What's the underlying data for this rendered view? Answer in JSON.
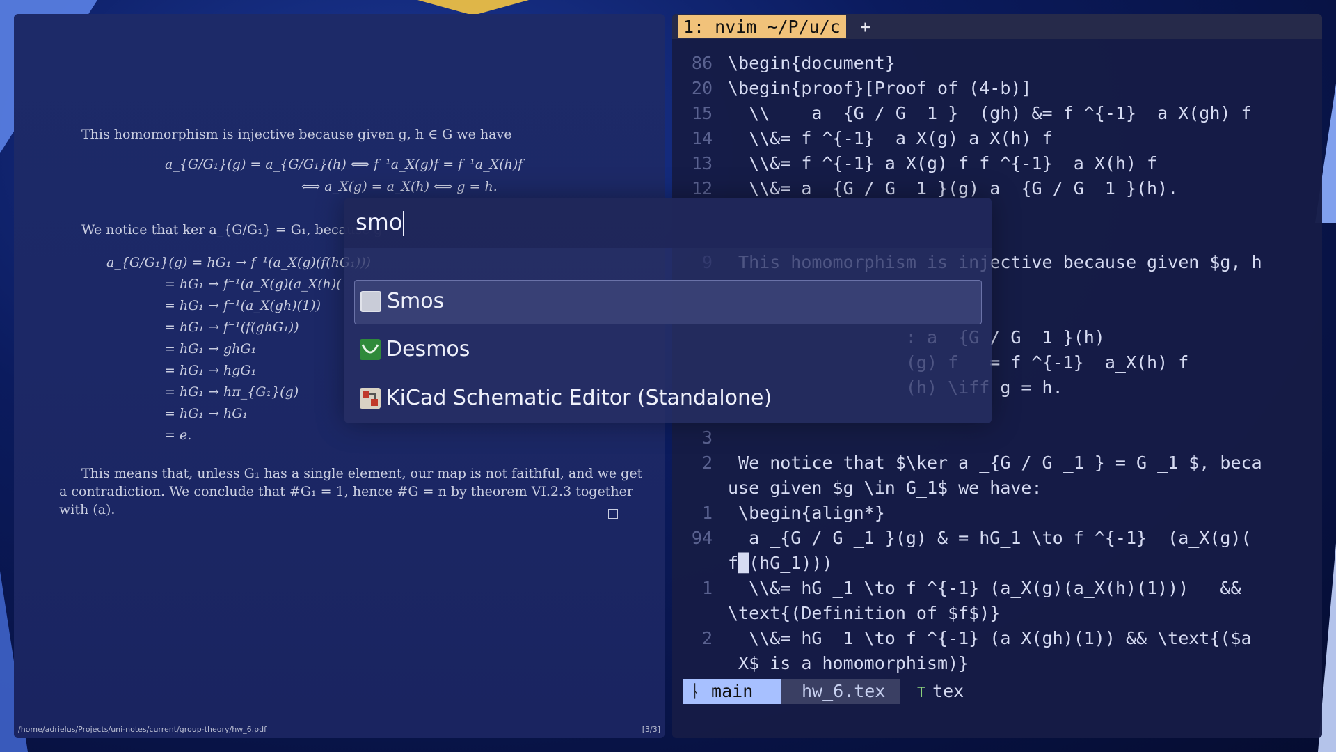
{
  "pdf": {
    "para1": "This homomorphism is injective because given g, h ∈ G we have",
    "eq1_l1": "a_{G/G₁}(g) = a_{G/G₁}(h)  ⟺  f⁻¹a_X(g)f = f⁻¹a_X(h)f",
    "eq1_l2": "⟺  a_X(g) = a_X(h)  ⟺  g = h.",
    "para2": "We notice that ker a_{G/G₁} = G₁, because g",
    "align_lines": [
      "a_{G/G₁}(g) = hG₁ → f⁻¹(a_X(g)(f(hG₁)))",
      "= hG₁ → f⁻¹(a_X(g)(a_X(h)(",
      "= hG₁ → f⁻¹(a_X(gh)(1))",
      "= hG₁ → f⁻¹(f(ghG₁))",
      "= hG₁ → ghG₁",
      "= hG₁ → hgG₁",
      "= hG₁ → hπ_{G₁}(g)",
      "= hG₁ → hG₁",
      "= e."
    ],
    "para3_l1": "This means that, unless G₁ has a single element, our map is not faithful, and we get",
    "para3_l2": "a contradiction. We conclude that #G₁ = 1, hence #G = n by theorem VI.2.3 together",
    "para3_l3": "with (a).",
    "path": "/home/adrielus/Projects/uni-notes/current/group-theory/hw_6.pdf",
    "page": "[3/3]"
  },
  "terminal": {
    "tab_label": "1: nvim ~/P/u/c",
    "tab_plus": "+",
    "lines": [
      {
        "num": "86",
        "text": "\\begin{document}"
      },
      {
        "num": "20",
        "text": "\\begin{proof}[Proof of (4-b)]"
      },
      {
        "num": "15",
        "text": "  \\\\    a _{G / G _1 }  (gh) &= f ^{-1}  a_X(gh) f"
      },
      {
        "num": "14",
        "text": "  \\\\&= f ^{-1}  a_X(g) a_X(h) f"
      },
      {
        "num": "13",
        "text": "  \\\\&= f ^{-1} a_X(g) f f ^{-1}  a_X(h) f"
      },
      {
        "num": "12",
        "text": "  \\\\&= a _{G / G _1 }(g) a _{G / G _1 }(h)."
      },
      {
        "num": "9",
        "text": " This homomorphism is injective because given $g, h"
      },
      {
        "num": "",
        "text": "                 : a _{G / G _1 }(h)"
      },
      {
        "num": "",
        "text": "                 (g) f   = f ^{-1}  a_X(h) f"
      },
      {
        "num": "",
        "text": "                 (h) \\iff g = h."
      },
      {
        "num": "3",
        "text": ""
      },
      {
        "num": "2",
        "text": " We notice that $\\ker a _{G / G _1 } = G _1 $, beca"
      },
      {
        "num": "",
        "text": "use given $g \\in G_1$ we have:"
      },
      {
        "num": "1",
        "text": " \\begin{align*}"
      },
      {
        "num": "94",
        "text": "  a _{G / G _1 }(g) & = hG_1 \\to f ^{-1}  (a_X(g)("
      },
      {
        "num": "",
        "text": "f█(hG_1)))"
      },
      {
        "num": "1",
        "text": "  \\\\&= hG _1 \\to f ^{-1} (a_X(g)(a_X(h)(1)))   &&"
      },
      {
        "num": "",
        "text": "\\text{(Definition of $f$)}"
      },
      {
        "num": "2",
        "text": "  \\\\&= hG _1 \\to f ^{-1} (a_X(gh)(1)) && \\text{($a"
      },
      {
        "num": "",
        "text": "_X$ is a homomorphism)}"
      }
    ],
    "status": {
      "branch": "ᚿ main",
      "file": "hw_6.tex",
      "type": "tex"
    }
  },
  "launcher": {
    "query": "smo",
    "results": [
      {
        "label": "Smos",
        "icon": "smos-icon",
        "selected": true
      },
      {
        "label": "Desmos",
        "icon": "desmos-icon",
        "selected": false
      },
      {
        "label": "KiCad Schematic Editor (Standalone)",
        "icon": "kicad-icon",
        "selected": false
      }
    ]
  }
}
